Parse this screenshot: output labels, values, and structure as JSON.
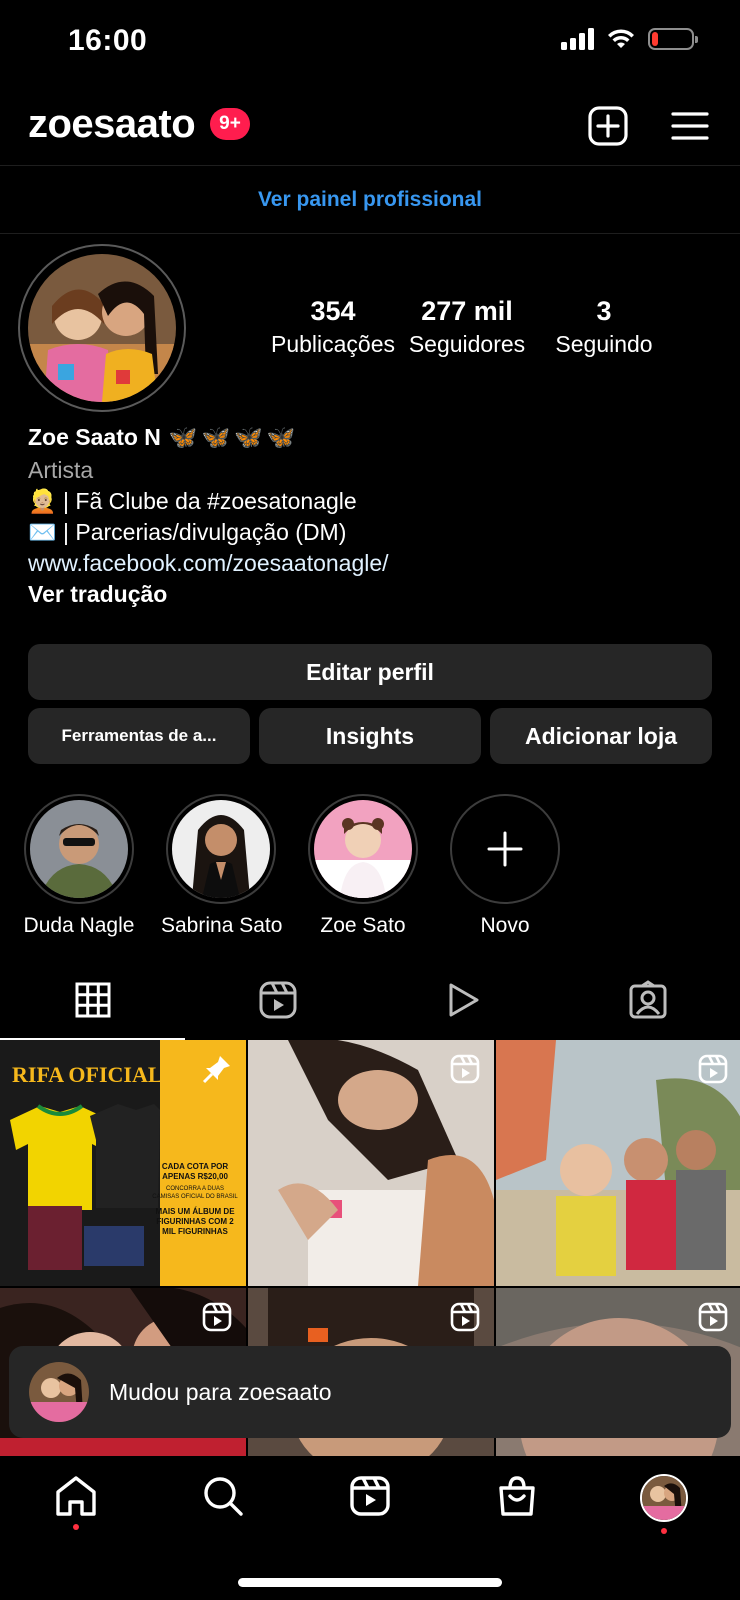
{
  "status_bar": {
    "time": "16:00"
  },
  "header": {
    "username": "zoesaato",
    "notification_badge": "9+"
  },
  "pro_dashboard": {
    "label": "Ver painel profissional"
  },
  "profile": {
    "stats": [
      {
        "value": "354",
        "label": "Publicações"
      },
      {
        "value": "277 mil",
        "label": "Seguidores"
      },
      {
        "value": "3",
        "label": "Seguindo"
      }
    ],
    "name": "Zoe Saato N",
    "name_emojis": "🦋🦋🦋🦋",
    "category": "Artista",
    "bio_lines": [
      {
        "emoji": "👱🏼",
        "text": " | Fã Clube da #zoesatonagle"
      },
      {
        "emoji": "✉️",
        "text": " | Parcerias/divulgação (DM)"
      }
    ],
    "link": "www.facebook.com/zoesaatonagle/",
    "translate": "Ver tradução"
  },
  "buttons": {
    "edit_profile": "Editar perfil",
    "tools": "Ferramentas de a...",
    "insights": "Insights",
    "add_shop": "Adicionar loja"
  },
  "highlights": [
    {
      "label": "Duda Nagle"
    },
    {
      "label": "Sabrina Sato"
    },
    {
      "label": "Zoe Sato"
    },
    {
      "label": "Novo"
    }
  ],
  "grid_posts": {
    "rifa": {
      "title": "RIFA OFICIAL",
      "line1": "CADA COTA POR",
      "line2": "APENAS R$20,00",
      "line3": "CONCORRA A DUAS CAMISAS OFICIAL DO BRASIL",
      "line4": "MAIS UM ÁLBUM DE FIGURINHAS COM 2 MIL FIGURINHAS"
    }
  },
  "toast": {
    "text": "Mudou para zoesaato"
  },
  "colors": {
    "accent_blue": "#3897f0",
    "badge_red": "#ff1d4e",
    "button_bg": "#262626"
  }
}
